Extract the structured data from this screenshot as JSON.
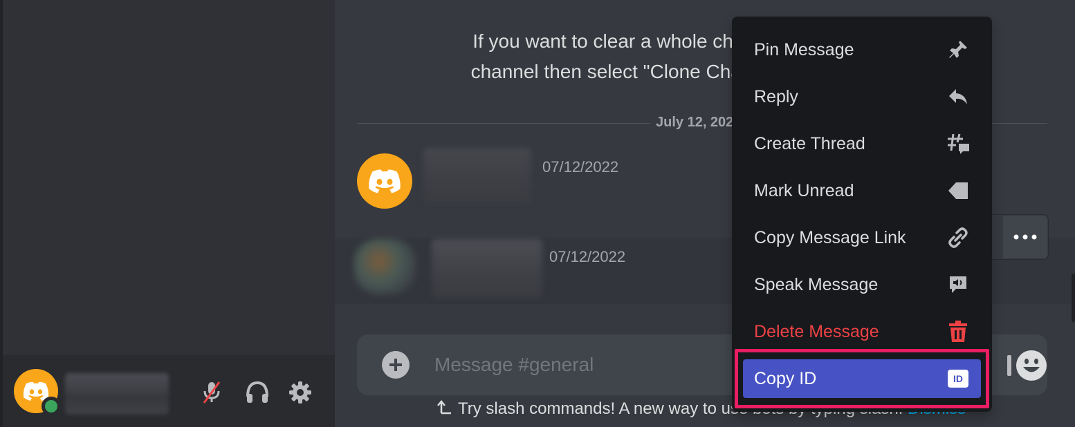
{
  "chat": {
    "system_message_line1": "If you want to clear a whole char",
    "system_message_line2": "channel then select \"Clone Chan",
    "date_divider": "July 12, 202",
    "messages": [
      {
        "timestamp": "07/12/2022"
      },
      {
        "timestamp": "07/12/2022"
      }
    ],
    "composer_placeholder": "Message #general",
    "tip_text": "Try slash commands! A new way to use bots by typing slash.",
    "tip_dismiss": "Dismiss"
  },
  "context_menu": {
    "items": [
      {
        "label": "Pin Message",
        "icon": "pin-icon"
      },
      {
        "label": "Reply",
        "icon": "reply-icon"
      },
      {
        "label": "Create Thread",
        "icon": "thread-icon"
      },
      {
        "label": "Mark Unread",
        "icon": "mark-unread-icon"
      },
      {
        "label": "Copy Message Link",
        "icon": "link-icon"
      },
      {
        "label": "Speak Message",
        "icon": "speak-icon"
      },
      {
        "label": "Delete Message",
        "icon": "trash-icon",
        "danger": true
      },
      {
        "label": "Copy ID",
        "icon": "id-icon",
        "active": true,
        "badge": "ID"
      }
    ]
  },
  "colors": {
    "accent": "#4752c4",
    "danger": "#ed4245",
    "highlight": "#e91e63",
    "avatar": "#faa61a",
    "online": "#3ba55d"
  }
}
